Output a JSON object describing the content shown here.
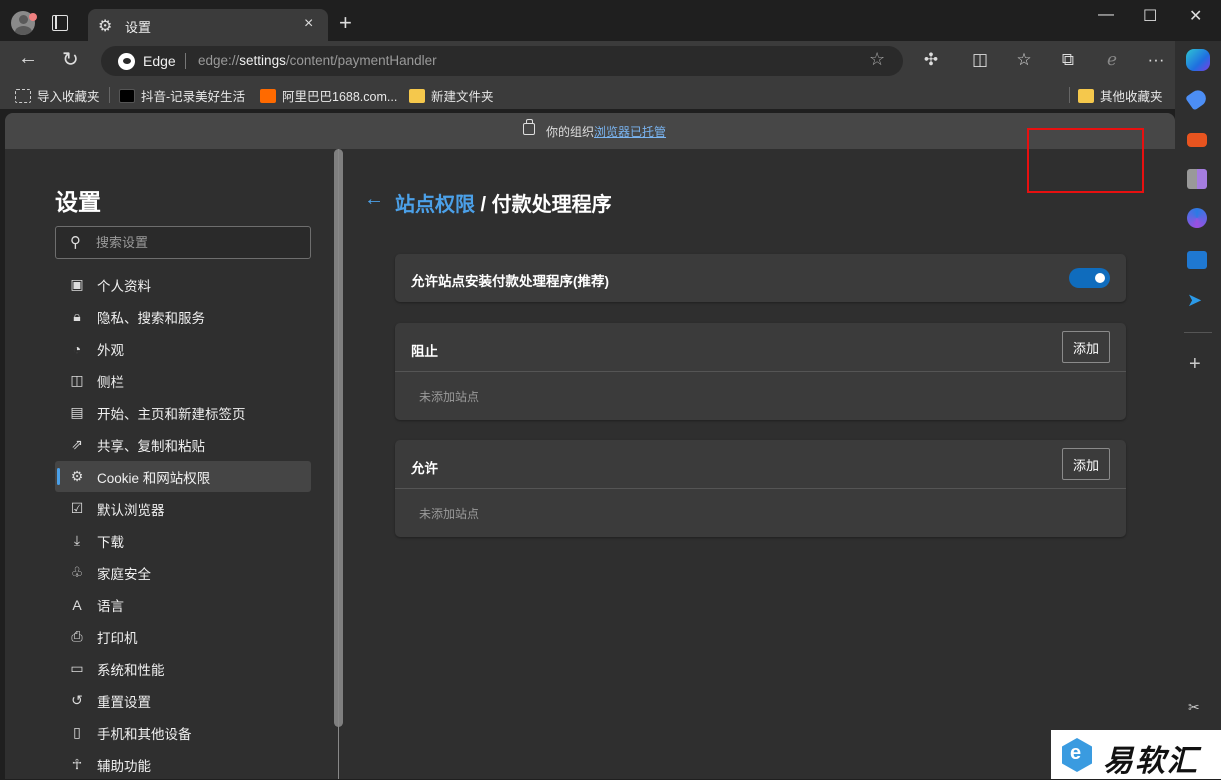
{
  "window": {
    "tab_title": "设置",
    "new_tab_symbol": "+",
    "minimize": "—",
    "maximize": "☐",
    "close": "✕"
  },
  "address_bar": {
    "brand": "Edge",
    "url_prefix": "edge://",
    "url_host": "settings",
    "url_path": "/content/paymentHandler"
  },
  "bookmarks": {
    "items": [
      {
        "label": "导入收藏夹",
        "icon": "import-icon"
      },
      {
        "label": "抖音-记录美好生活",
        "icon": "douyin-icon",
        "color": "#000000"
      },
      {
        "label": "阿里巴巴1688.com...",
        "icon": "alibaba-icon",
        "color": "#ff6a00"
      },
      {
        "label": "新建文件夹",
        "icon": "folder-icon",
        "color": "#f5c84c"
      }
    ],
    "other": {
      "label": "其他收藏夹",
      "icon": "folder-icon",
      "color": "#f5c84c"
    }
  },
  "banner": {
    "text": "你的组织",
    "link": "浏览器已托管"
  },
  "settings": {
    "title": "设置",
    "search_placeholder": "搜索设置",
    "nav": [
      {
        "label": "个人资料",
        "icon": "profile-icon",
        "glyph": "▣"
      },
      {
        "label": "隐私、搜索和服务",
        "icon": "lock-icon",
        "glyph": "🔒︎"
      },
      {
        "label": "外观",
        "icon": "palette-icon",
        "glyph": "◔"
      },
      {
        "label": "侧栏",
        "icon": "sidebar-icon",
        "glyph": "◫"
      },
      {
        "label": "开始、主页和新建标签页",
        "icon": "home-tab-icon",
        "glyph": "▤"
      },
      {
        "label": "共享、复制和粘贴",
        "icon": "share-icon",
        "glyph": "⇗"
      },
      {
        "label": "Cookie 和网站权限",
        "icon": "cookie-site-icon",
        "glyph": "⚙",
        "active": true
      },
      {
        "label": "默认浏览器",
        "icon": "default-browser-icon",
        "glyph": "☑"
      },
      {
        "label": "下载",
        "icon": "download-icon",
        "glyph": "⤓"
      },
      {
        "label": "家庭安全",
        "icon": "family-icon",
        "glyph": "♧"
      },
      {
        "label": "语言",
        "icon": "language-icon",
        "glyph": "A"
      },
      {
        "label": "打印机",
        "icon": "printer-icon",
        "glyph": "⎙"
      },
      {
        "label": "系统和性能",
        "icon": "laptop-icon",
        "glyph": "▭"
      },
      {
        "label": "重置设置",
        "icon": "reset-icon",
        "glyph": "↺"
      },
      {
        "label": "手机和其他设备",
        "icon": "phone-icon",
        "glyph": "▯"
      },
      {
        "label": "辅助功能",
        "icon": "accessibility-icon",
        "glyph": "☥"
      }
    ]
  },
  "main": {
    "breadcrumb_parent": "站点权限",
    "breadcrumb_sep": " / ",
    "breadcrumb_current": "付款处理程序",
    "toggle_card": {
      "label": "允许站点安装付款处理程序(推荐)",
      "enabled": true
    },
    "block_card": {
      "title": "阻止",
      "add_label": "添加",
      "empty_text": "未添加站点"
    },
    "allow_card": {
      "title": "允许",
      "add_label": "添加",
      "empty_text": "未添加站点"
    }
  },
  "colors": {
    "accent": "#4ba0e8",
    "toggle_on": "#0f6cbd",
    "highlight": "#e81010"
  },
  "watermark": {
    "text": "易软汇"
  }
}
